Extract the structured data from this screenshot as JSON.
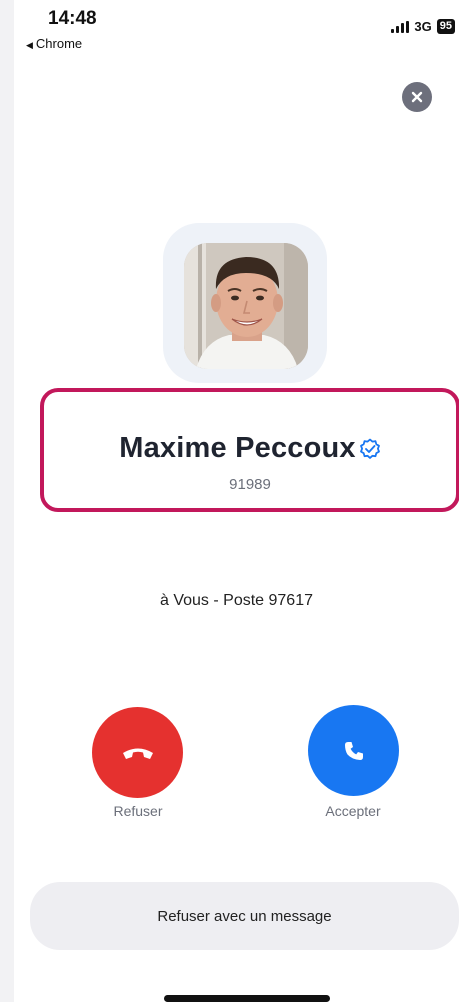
{
  "status_bar": {
    "time": "14:48",
    "back_label": "Chrome",
    "network": "3G",
    "battery": "95"
  },
  "caller": {
    "name": "Maxime Peccoux",
    "number": "91989",
    "verified": true
  },
  "destination": "à Vous - Poste 97617",
  "actions": {
    "decline_label": "Refuser",
    "accept_label": "Accepter",
    "message_label": "Refuser avec un message"
  },
  "colors": {
    "decline": "#e5312f",
    "accept": "#1877f2",
    "highlight_border": "#c2185b",
    "verified_badge": "#1877f2"
  }
}
